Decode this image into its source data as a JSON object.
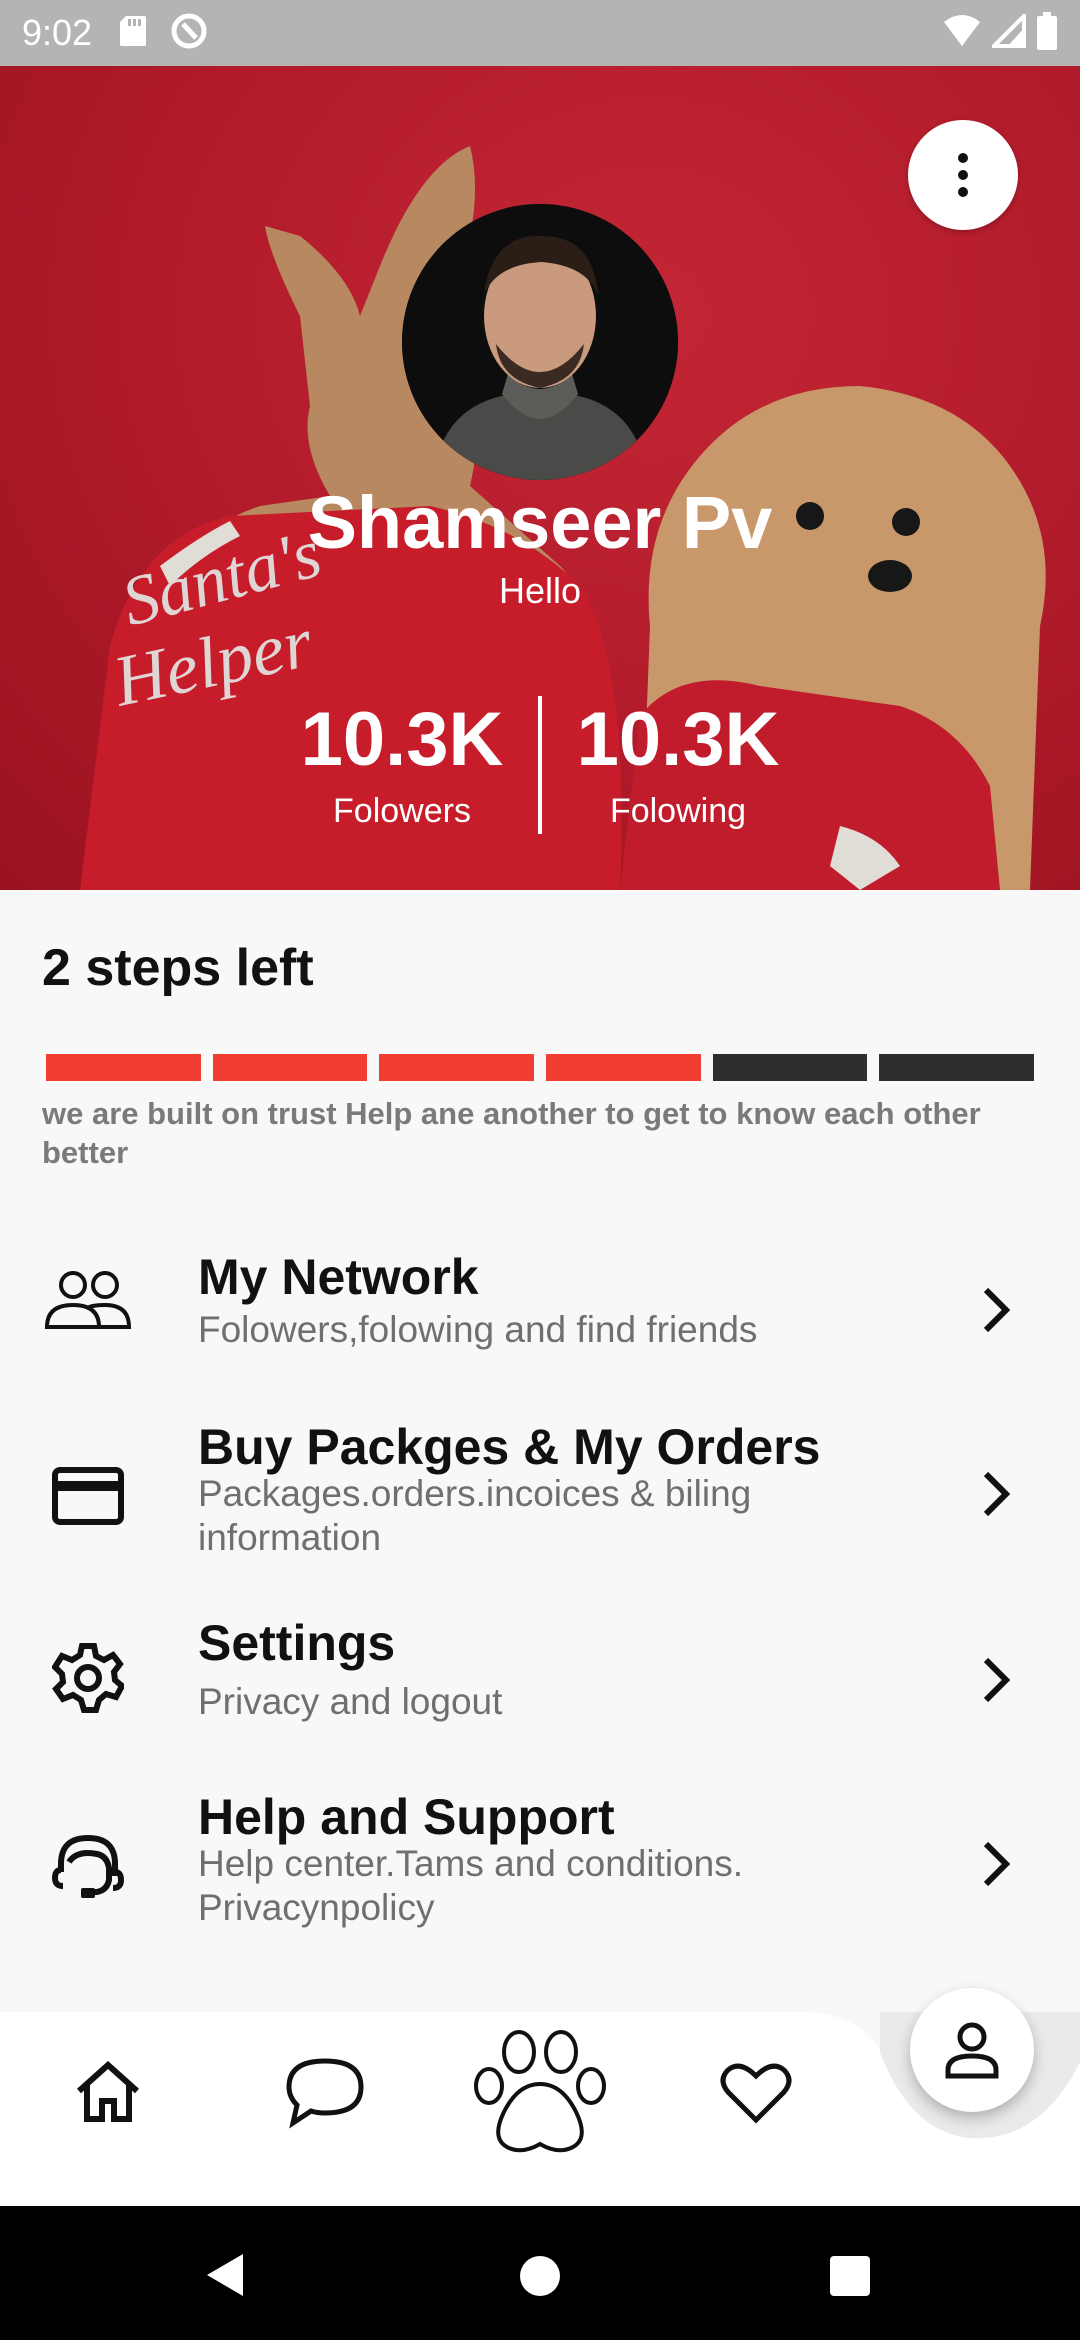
{
  "status_bar": {
    "time": "9:02"
  },
  "profile": {
    "name": "Shamseer Pv",
    "status": "Hello",
    "followers_value": "10.3K",
    "followers_label": "Folowers",
    "following_value": "10.3K",
    "following_label": "Folowing"
  },
  "steps": {
    "title": "2 steps left",
    "description": "we are built on trust Help ane another to get to know each other better",
    "completed": 4,
    "total": 6,
    "done_color": "#f23d33",
    "todo_color": "#2e2e2e"
  },
  "menu": {
    "items": [
      {
        "title": "My Network",
        "subtitle": "Folowers,folowing and find friends",
        "icon": "people-icon"
      },
      {
        "title": "Buy Packges & My Orders",
        "subtitle": "Packages.orders.incoices & biling information",
        "icon": "credit-card-icon"
      },
      {
        "title": "Settings",
        "subtitle": "Privacy and logout",
        "icon": "gear-icon"
      },
      {
        "title": "Help and Support",
        "subtitle": "Help center.Tams and conditions. Privacynpolicy",
        "icon": "headset-icon"
      }
    ]
  },
  "bottom_nav": {
    "items": [
      "home-icon",
      "chat-icon",
      "paw-icon",
      "heart-icon",
      "profile-icon"
    ],
    "active": "profile-icon"
  },
  "colors": {
    "accent": "#f23d33",
    "hero_red": "#c41f30"
  }
}
